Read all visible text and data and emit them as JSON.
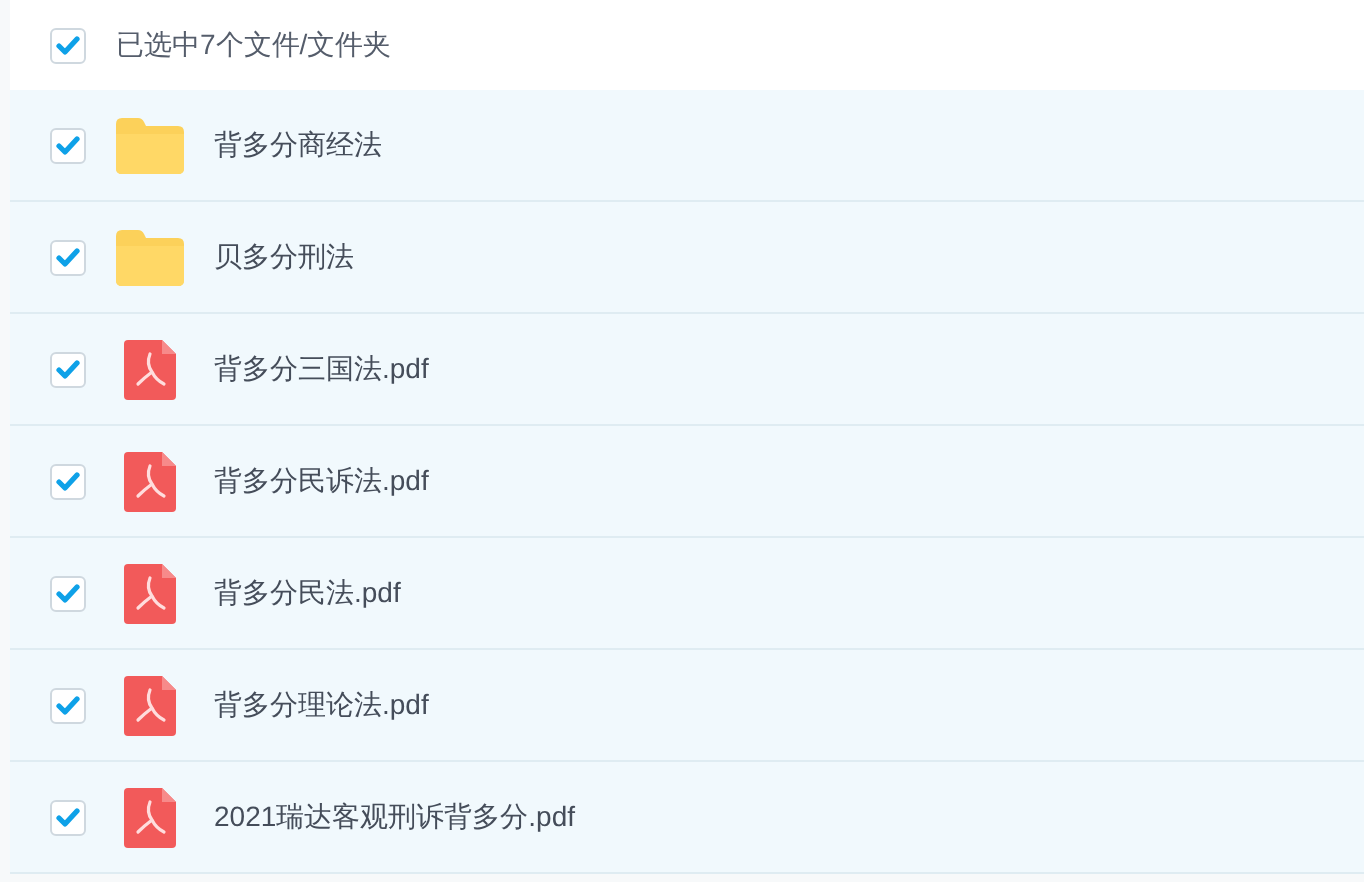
{
  "header": {
    "label": "已选中7个文件/文件夹",
    "checked": true
  },
  "files": [
    {
      "name": "背多分商经法",
      "kind": "folder",
      "checked": true
    },
    {
      "name": "贝多分刑法",
      "kind": "folder",
      "checked": true
    },
    {
      "name": "背多分三国法.pdf",
      "kind": "pdf",
      "checked": true
    },
    {
      "name": "背多分民诉法.pdf",
      "kind": "pdf",
      "checked": true
    },
    {
      "name": "背多分民法.pdf",
      "kind": "pdf",
      "checked": true
    },
    {
      "name": "背多分理论法.pdf",
      "kind": "pdf",
      "checked": true
    },
    {
      "name": "2021瑞达客观刑诉背多分.pdf",
      "kind": "pdf",
      "checked": true
    }
  ]
}
